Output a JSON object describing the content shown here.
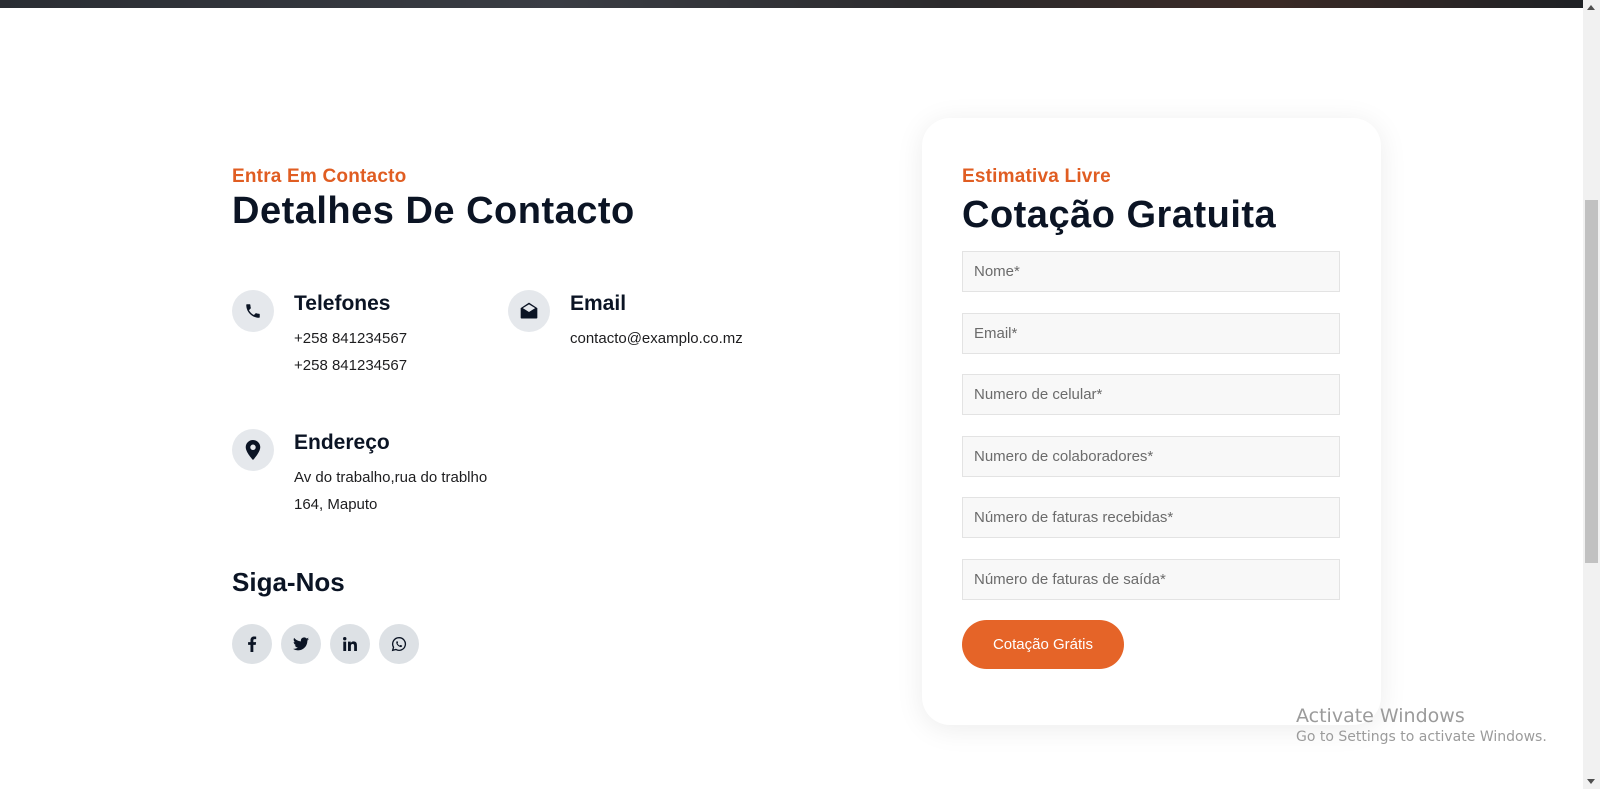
{
  "contact": {
    "eyebrow": "Entra Em Contacto",
    "heading": "Detalhes De Contacto",
    "phones": {
      "title": "Telefones",
      "icon": "phone-icon",
      "lines": [
        "+258 841234567",
        "+258 841234567"
      ]
    },
    "email": {
      "title": "Email",
      "icon": "envelope-open-icon",
      "lines": [
        "contacto@examplo.co.mz"
      ]
    },
    "address": {
      "title": "Endereço",
      "icon": "map-pin-icon",
      "lines": [
        "Av do trabalho,rua do trablho",
        "164, Maputo"
      ]
    },
    "follow": {
      "title": "Siga-Nos",
      "socials": [
        "facebook-icon",
        "twitter-icon",
        "linkedin-icon",
        "whatsapp-icon"
      ]
    }
  },
  "quote": {
    "eyebrow": "Estimativa Livre",
    "heading": "Cotação Gratuita",
    "fields": [
      {
        "placeholder": "Nome*",
        "value": ""
      },
      {
        "placeholder": "Email*",
        "value": ""
      },
      {
        "placeholder": "Numero de celular*",
        "value": ""
      },
      {
        "placeholder": "Numero de colaboradores*",
        "value": ""
      },
      {
        "placeholder": "Número de faturas recebidas*",
        "value": ""
      },
      {
        "placeholder": "Número de faturas de saída*",
        "value": ""
      }
    ],
    "submit_label": "Cotação Grátis"
  },
  "watermark": {
    "title": "Activate Windows",
    "subtitle": "Go to Settings to activate Windows."
  },
  "colors": {
    "accent": "#e56428",
    "heading": "#0b1424",
    "icon_bg": "#e5e8ec"
  }
}
